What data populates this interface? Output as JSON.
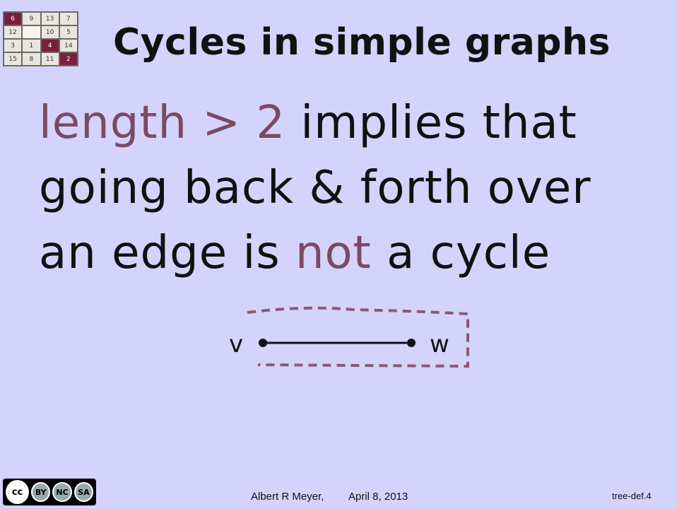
{
  "logo": {
    "cells": [
      "6",
      "9",
      "13",
      "7",
      "12",
      "",
      "10",
      "5",
      "3",
      "1",
      "4",
      "14",
      "15",
      "8",
      "11",
      "2"
    ]
  },
  "slide": {
    "title": "Cycles in simple graphs",
    "line1_hl": "length > 2",
    "line1_rest": " implies that",
    "line2": "going back & forth over",
    "line3_a": "an edge is ",
    "line3_hl": "not",
    "line3_b": " a cycle"
  },
  "diagram": {
    "vertex_left": "v",
    "vertex_right": "w"
  },
  "colors": {
    "background": "#d4d3fb",
    "highlight": "#7a4a65",
    "dashed_path": "#8a5a78",
    "logo_dark": "#7a1f3e"
  },
  "footer": {
    "author": "Albert R Meyer,",
    "date": "April 8, 2013",
    "ref": "tree-def.4"
  },
  "license": {
    "cc": "cc",
    "labels": [
      "BY",
      "NC",
      "SA"
    ]
  }
}
